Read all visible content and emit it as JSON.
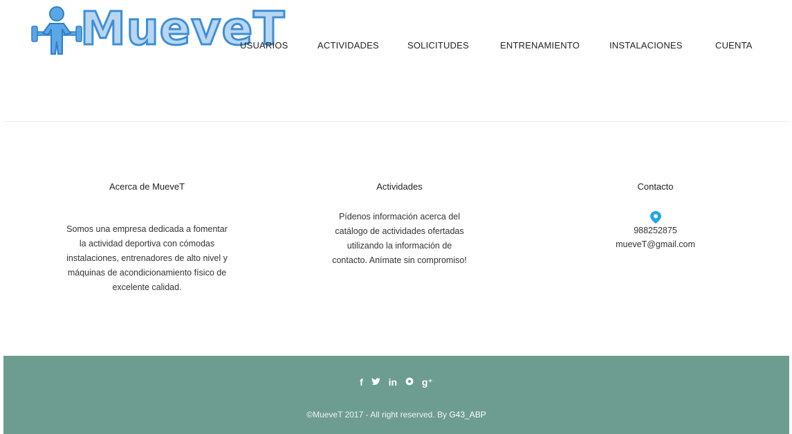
{
  "logo": {
    "text": "MueveT",
    "icon": "weightlifter-icon"
  },
  "nav": {
    "items": [
      {
        "label": "USUARIOS"
      },
      {
        "label": "ACTIVIDADES"
      },
      {
        "label": "SOLICITUDES"
      },
      {
        "label": "ENTRENAMIENTO"
      },
      {
        "label": "INSTALACIONES"
      },
      {
        "label": "CUENTA"
      }
    ]
  },
  "about": {
    "title": "Acerca de MueveT",
    "text": "Somos una empresa dedicada a fomentar la actividad deportiva con cómodas instalaciones, entrenadores de alto nivel y máquinas de acondicionamiento físico de excelente calidad."
  },
  "activities": {
    "title": "Actividades",
    "text": "Pídenos información acerca del catálogo de actividades ofertadas utilizando la información de contacto. Anímate sin compromiso!"
  },
  "contact": {
    "title": "Contacto",
    "icon": "location-pin-icon",
    "phone": "988252875",
    "email": "mueveT@gmail.com"
  },
  "footer": {
    "social": {
      "facebook": "f",
      "twitter": "🐦",
      "linkedin": "in",
      "pinterest": "℗",
      "googleplus": "g⁺"
    },
    "copyright": "©MueveT 2017 - All right reserved. By ",
    "author_link": "G43_ABP"
  },
  "colors": {
    "footer_bg": "#6d9d90",
    "logo_blue": "#3d8fd6",
    "pin_blue": "#1ea7e6"
  }
}
